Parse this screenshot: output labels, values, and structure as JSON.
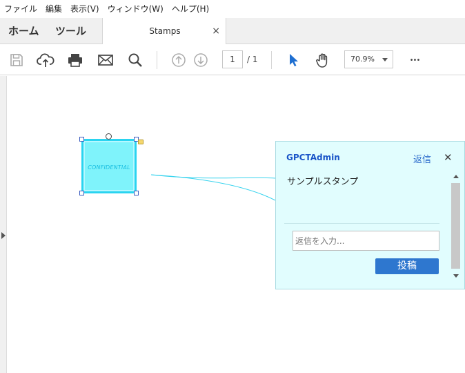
{
  "menu": {
    "items": [
      {
        "label": "ファイル"
      },
      {
        "label": "編集"
      },
      {
        "label": "表示(V)"
      },
      {
        "label": "ウィンドウ(W)"
      },
      {
        "label": "ヘルプ(H)"
      }
    ]
  },
  "tabs": {
    "home": "ホーム",
    "tools": "ツール",
    "document": "Stamps",
    "close_glyph": "×"
  },
  "toolbar": {
    "page_current": "1",
    "page_total": "/  1",
    "zoom": "70.9%",
    "more_glyph": "•••",
    "icons": [
      "save-icon",
      "upload-icon",
      "print-icon",
      "mail-icon",
      "search-icon",
      "arrow-up-icon",
      "arrow-down-icon",
      "pointer-icon",
      "hand-icon",
      "more-icon"
    ],
    "accent_color": "#2a6acb"
  },
  "stamp": {
    "text": "CONFIDENTIAL",
    "fill_color": "#7ff3fb",
    "border_color": "#2ad4f0"
  },
  "comment": {
    "author": "GPCTAdmin",
    "reply_link": "返信",
    "close_glyph": "✕",
    "body": "サンプルスタンプ",
    "reply_placeholder": "返信を入力...",
    "post_button": "投稿",
    "background_color": "#e1fdfe"
  }
}
